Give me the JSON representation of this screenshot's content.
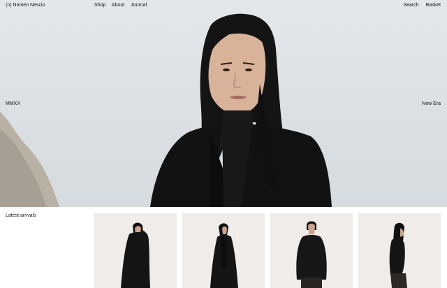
{
  "header": {
    "brand": "(n) Nomen Nescio",
    "nav": [
      "Shop",
      "About",
      "Journal"
    ],
    "right_nav": [
      "Search",
      "Basket"
    ]
  },
  "hero": {
    "caption_left": "MMXX",
    "caption_right": "New Era"
  },
  "latest": {
    "label": "Latest arrivals",
    "products": [
      {
        "name": "hooded-coat"
      },
      {
        "name": "long-coat"
      },
      {
        "name": "hoodie"
      },
      {
        "name": "side-profile-look"
      }
    ]
  },
  "colors": {
    "sky": "#dde1e5",
    "garment": "#111111",
    "product_bg": "#efecea",
    "text": "#111111"
  }
}
